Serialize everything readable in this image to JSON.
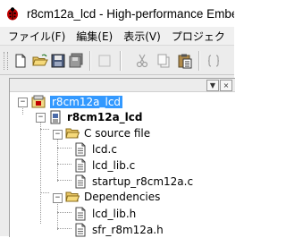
{
  "window": {
    "title": "r8cm12a_lcd - High-performance Embed",
    "icon": "ladybug-app-icon"
  },
  "menu": {
    "items": [
      "ファイル(F)",
      "編集(E)",
      "表示(V)",
      "プロジェク"
    ]
  },
  "toolbar": {
    "buttons": [
      "new-file-icon",
      "open-folder-icon",
      "save-icon",
      "save-all-icon",
      "cut-icon",
      "copy-icon",
      "paste-icon",
      "bracket-icon"
    ]
  },
  "panel": {
    "buttons": {
      "pin": "▼",
      "close": "×"
    }
  },
  "tree": {
    "workspace": {
      "label": "r8cm12a_lcd"
    },
    "project": {
      "label": "r8cm12a_lcd"
    },
    "c_source_folder": {
      "label": "C source file",
      "files": [
        "lcd.c",
        "lcd_lib.c",
        "startup_r8cm12a.c"
      ]
    },
    "dependencies_folder": {
      "label": "Dependencies",
      "files": [
        "lcd_lib.h",
        "sfr_r8m12a.h"
      ]
    }
  },
  "colors": {
    "selection": "#3399ff",
    "panel_background": "#ececec",
    "folder": "#e8c564"
  }
}
